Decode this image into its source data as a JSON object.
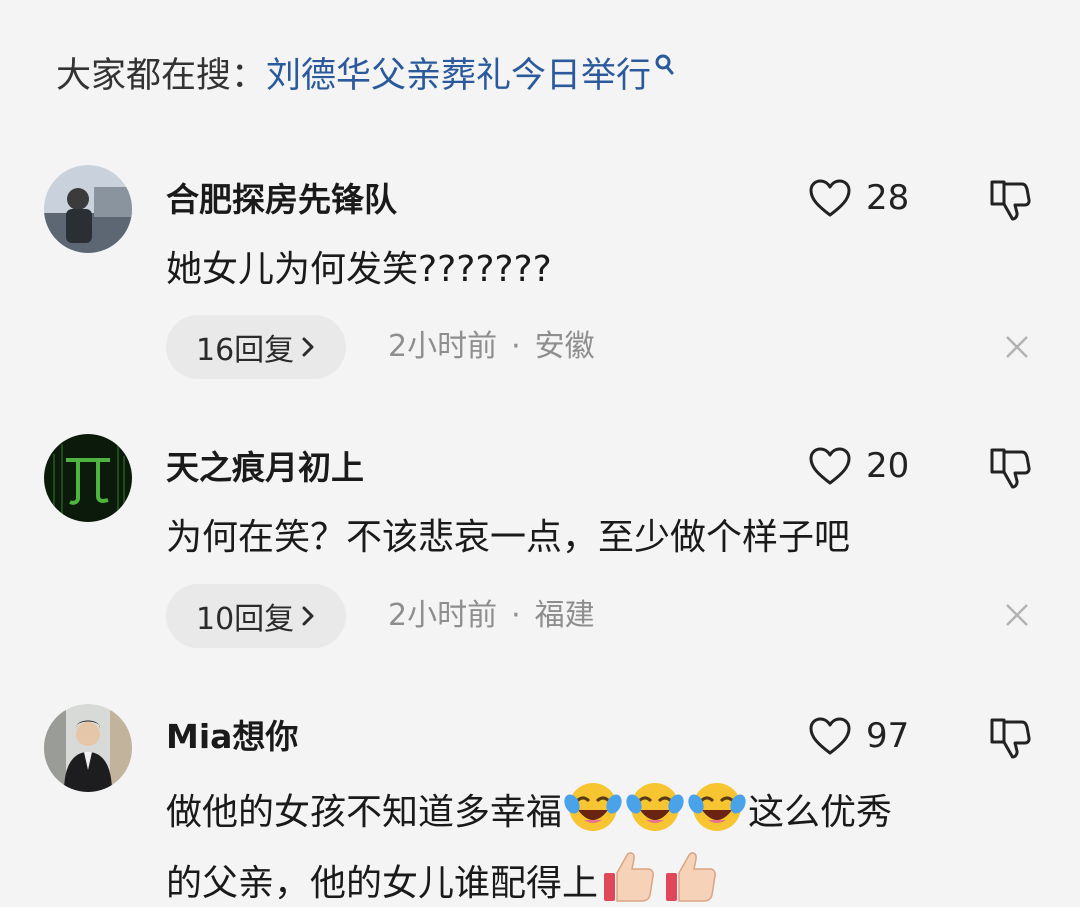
{
  "search_hint": {
    "prefix": "大家都在搜：",
    "query": "刘德华父亲葬礼今日举行"
  },
  "comments": [
    {
      "username": "合肥探房先锋队",
      "likes": "28",
      "text": "她女儿为何发笑???????",
      "replies_label": "16回复",
      "time": "2小时前",
      "location": "安徽"
    },
    {
      "username": "天之痕月初上",
      "likes": "20",
      "text": "为何在笑？不该悲哀一点，至少做个样子吧",
      "replies_label": "10回复",
      "time": "2小时前",
      "location": "福建"
    },
    {
      "username": "Mia想你",
      "likes": "97",
      "text_part1": "做他的女孩不知道多幸福",
      "text_part2": "这么优秀",
      "text_part3": "的父亲，他的女儿谁配得上",
      "emoji_1": "laughing-crying",
      "emoji_2": "thumbs-up"
    }
  ],
  "separator_dot": "·",
  "colors": {
    "background": "#f4f4f4",
    "link": "#2a5a9c",
    "meta": "#8e8e8e",
    "pill": "#e9e9e9"
  }
}
